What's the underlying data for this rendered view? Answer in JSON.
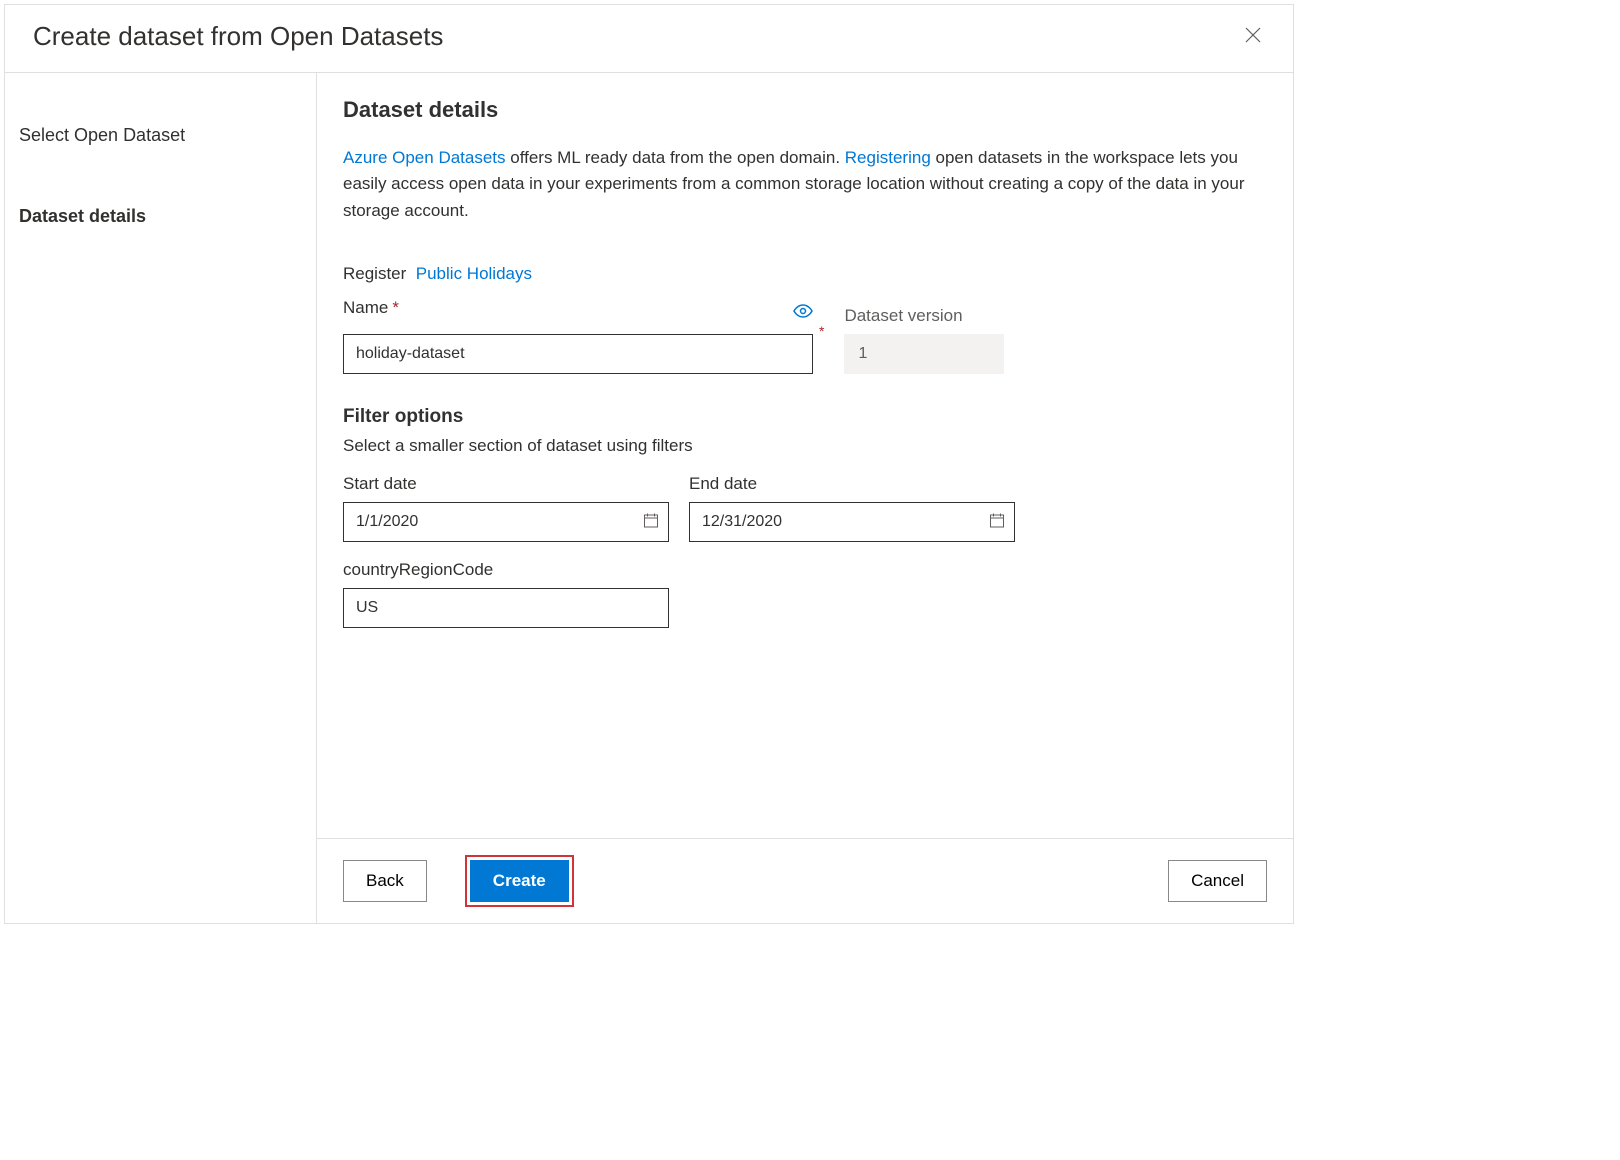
{
  "header": {
    "title": "Create dataset from Open Datasets"
  },
  "sidebar": {
    "item1": "Select Open Dataset",
    "item2": "Dataset details"
  },
  "content": {
    "section_title": "Dataset details",
    "desc_link1": "Azure Open Datasets",
    "desc_text1": " offers ML ready data from the open domain. ",
    "desc_link2": "Registering",
    "desc_text2": " open datasets in the workspace lets you easily access open data in your experiments from a common storage location without creating a copy of the data in your storage account.",
    "register_label": "Register",
    "register_link": "Public Holidays",
    "name_label": "Name",
    "name_value": "holiday-dataset",
    "version_label": "Dataset version",
    "version_value": "1",
    "filter_title": "Filter options",
    "filter_sub": "Select a smaller section of dataset using filters",
    "start_label": "Start date",
    "start_value": "1/1/2020",
    "end_label": "End date",
    "end_value": "12/31/2020",
    "cc_label": "countryRegionCode",
    "cc_value": "US"
  },
  "footer": {
    "back": "Back",
    "create": "Create",
    "cancel": "Cancel"
  }
}
